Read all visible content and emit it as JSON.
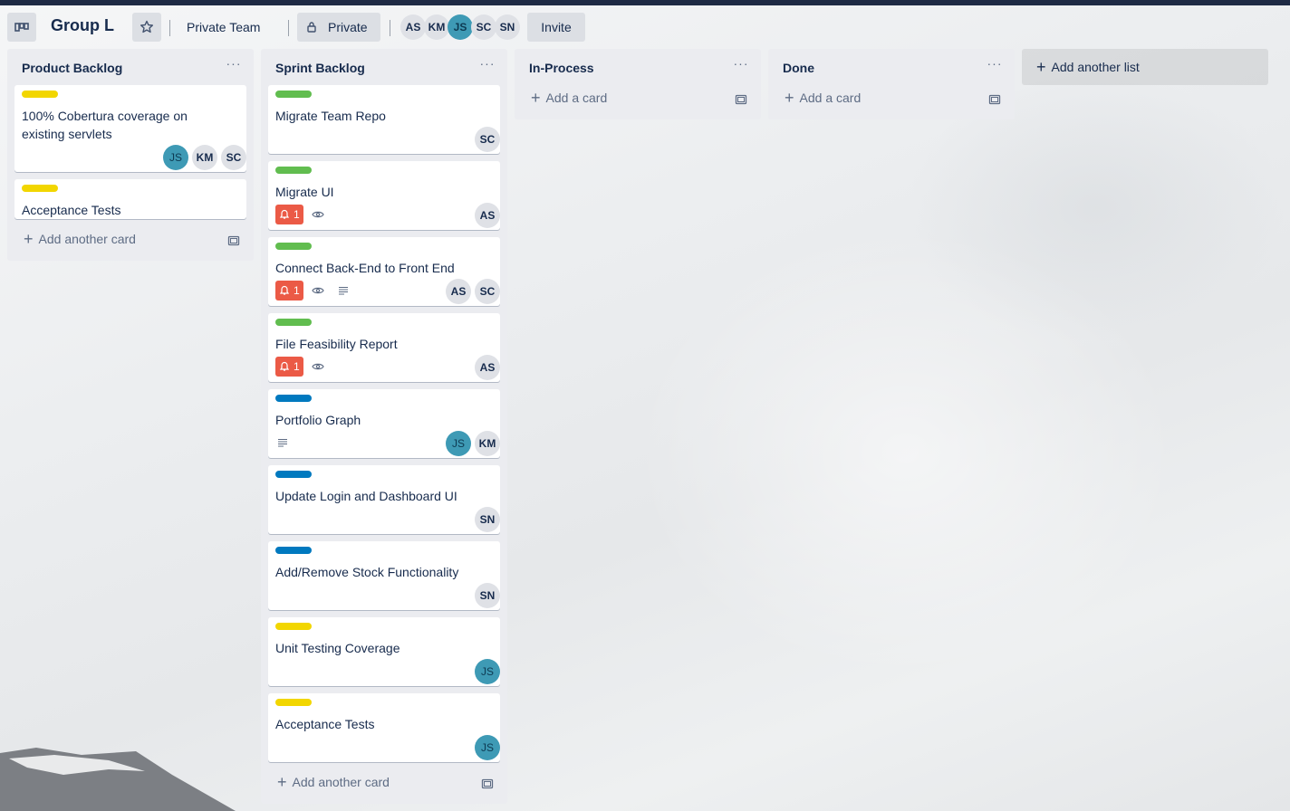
{
  "header": {
    "board_title": "Group L",
    "team_label": "Private Team",
    "visibility_label": "Private",
    "invite_label": "Invite",
    "members": [
      "AS",
      "KM",
      "JS",
      "SC",
      "SN"
    ]
  },
  "lists": [
    {
      "title": "Product Backlog",
      "menu": "···",
      "cards": [
        {
          "label_color": "#f2d600",
          "title": "100% Cobertura coverage on existing servlets",
          "members": [
            "JS",
            "KM",
            "SC"
          ]
        },
        {
          "label_color": "#f2d600",
          "title": "Acceptance Tests",
          "members": []
        }
      ],
      "footer": "Add another card"
    },
    {
      "title": "Sprint Backlog",
      "menu": "···",
      "cards": [
        {
          "label_color": "#61bd4f",
          "title": "Migrate Team Repo",
          "members": [
            "SC"
          ]
        },
        {
          "label_color": "#61bd4f",
          "title": "Migrate UI",
          "due_count": "1",
          "watch": true,
          "members": [
            "AS"
          ]
        },
        {
          "label_color": "#61bd4f",
          "title": "Connect Back-End to Front End",
          "due_count": "1",
          "watch": true,
          "description": true,
          "members": [
            "AS",
            "SC"
          ]
        },
        {
          "label_color": "#61bd4f",
          "title": "File Feasibility Report",
          "due_count": "1",
          "watch": true,
          "members": [
            "AS"
          ]
        },
        {
          "label_color": "#0079bf",
          "title": "Portfolio Graph",
          "description": true,
          "members": [
            "JS",
            "KM"
          ]
        },
        {
          "label_color": "#0079bf",
          "title": "Update Login and Dashboard UI",
          "members": [
            "SN"
          ]
        },
        {
          "label_color": "#0079bf",
          "title": "Add/Remove Stock Functionality",
          "members": [
            "SN"
          ]
        },
        {
          "label_color": "#f2d600",
          "title": "Unit Testing Coverage",
          "members": [
            "JS"
          ]
        },
        {
          "label_color": "#f2d600",
          "title": "Acceptance Tests",
          "members": [
            "JS"
          ]
        }
      ],
      "footer": "Add another card"
    },
    {
      "title": "In-Process",
      "menu": "···",
      "cards": [],
      "footer": "Add a card"
    },
    {
      "title": "Done",
      "menu": "···",
      "cards": [],
      "footer": "Add a card"
    }
  ],
  "add_list_label": "Add another list",
  "colors": {
    "avatar_js": "#3e9ab5",
    "due_badge": "#eb5a46",
    "list_bg": "#ebecf0"
  }
}
